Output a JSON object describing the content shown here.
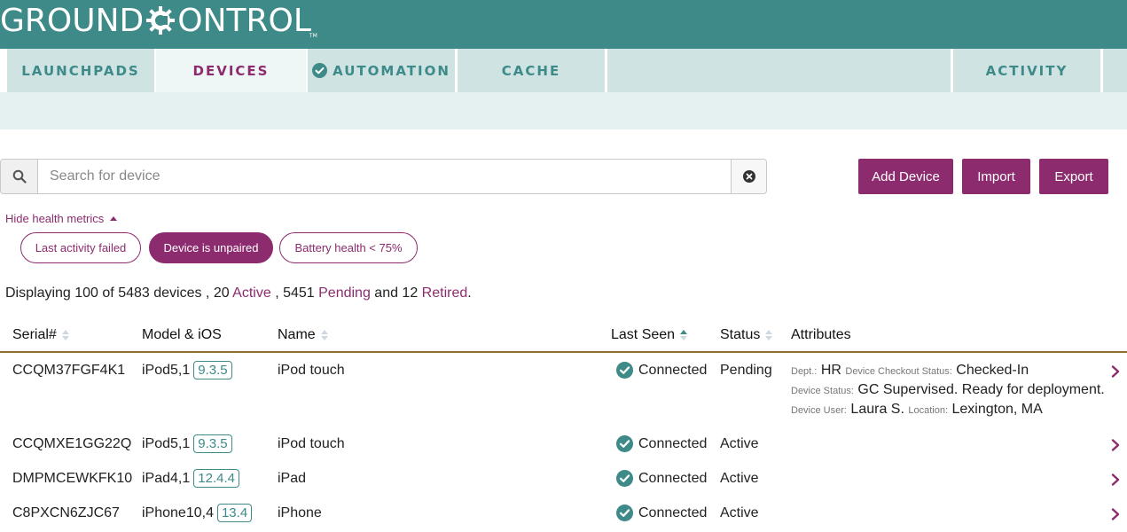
{
  "brand": {
    "logo_left": "GROUND",
    "logo_right": "ONTROL",
    "logo_tm": "TM",
    "primary_color": "#3d8a88",
    "accent_color": "#8c2c6e"
  },
  "nav": {
    "tabs": [
      {
        "label": "LAUNCHPADS"
      },
      {
        "label": "DEVICES"
      },
      {
        "label": "AUTOMATION"
      },
      {
        "label": "CACHE"
      },
      {
        "label": ""
      },
      {
        "label": "ACTIVITY"
      }
    ]
  },
  "search": {
    "placeholder": "Search for device",
    "value": ""
  },
  "actions": {
    "add_device": "Add Device",
    "import": "Import",
    "export": "Export"
  },
  "health": {
    "toggle_label": "Hide health metrics",
    "filters": [
      {
        "label": "Last activity failed",
        "active": false
      },
      {
        "label": "Device is unpaired",
        "active": true
      },
      {
        "label": "Battery health < 75%",
        "active": false
      }
    ]
  },
  "summary": {
    "prefix": "Displaying 100 of 5483 devices , 20 ",
    "active": "Active",
    "mid1": " , 5451 ",
    "pending": "Pending",
    "mid2": " and 12 ",
    "retired": "Retired",
    "suffix": "."
  },
  "table": {
    "columns": {
      "serial": "Serial#",
      "model": "Model & iOS",
      "name": "Name",
      "last_seen": "Last Seen",
      "status": "Status",
      "attributes": "Attributes"
    },
    "rows": [
      {
        "serial": "CCQM37FGF4K1",
        "model": "iPod5,1",
        "ios": "9.3.5",
        "name": "iPod touch",
        "last_seen": "Connected",
        "status": "Pending",
        "attributes": {
          "dept_key": "Dept.:",
          "dept_val": "HR",
          "checkout_key": "Device Checkout Status:",
          "checkout_val": "Checked-In",
          "status_key": "Device Status:",
          "status_val": "GC Supervised. Ready for deployment.",
          "user_key": "Device User:",
          "user_val": "Laura S.",
          "loc_key": "Location:",
          "loc_val": "Lexington, MA"
        }
      },
      {
        "serial": "CCQMXE1GG22Q",
        "model": "iPod5,1",
        "ios": "9.3.5",
        "name": "iPod touch",
        "last_seen": "Connected",
        "status": "Active"
      },
      {
        "serial": "DMPMCEWKFK10",
        "model": "iPad4,1",
        "ios": "12.4.4",
        "name": "iPad",
        "last_seen": "Connected",
        "status": "Active"
      },
      {
        "serial": "C8PXCN6ZJC67",
        "model": "iPhone10,4",
        "ios": "13.4",
        "name": "iPhone",
        "last_seen": "Connected",
        "status": "Active"
      }
    ]
  }
}
